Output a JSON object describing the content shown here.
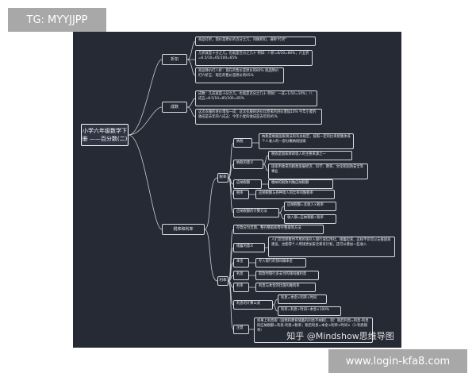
{
  "overlay": {
    "tag": "TG: MYYJJPP",
    "banner": "www.login-kfa8.com"
  },
  "watermark": "知乎 @Mindshow思维导图",
  "mindmap": {
    "root": "小学六年级数学下册 ——百分数(二)",
    "discount": {
      "title": "折扣",
      "items": [
        "商品打折，现价是原价的百分之几，叫做折扣，通称\"打折\"",
        "几折就是十分之几，也就是百分之几十 例如：八折=8/10=80%；六五折=6.5/10=65/100=65%",
        "商品降价打八折：现在的售价是原价的80% 商品降价打六折五：现在的售价是原价的65%"
      ]
    },
    "chengshu": {
      "title": "成数",
      "items": [
        "成数：几成就是十分之几，也就是百分之几十 例如：一成=1/10=10%；八成五=8.5/10=85/100=85%",
        "这次衣服的进价增加一成：这次衣服的进价比原来的进价增加10% 今年小麦的收成是去年的八成五：今年小麦的收成是去年的85%"
      ]
    },
    "tax": {
      "title": "税率和利率",
      "shuilv": {
        "title": "税率",
        "nashui": {
          "label": "纳税",
          "text": "纳税是根据国家税法的有关规定，按照一定的比率把集体或个人收入的一部分缴纳给国家"
        },
        "yiyi": {
          "label": "纳税的意义",
          "items": [
            "税收是国家财政收入的主要来源之一",
            "国家用收来的税款发展经济、科学、教育、文化和国防安全等事业"
          ]
        },
        "ynse": {
          "label": "应纳税额",
          "text": "缴纳的税款叫做应纳税额"
        },
        "rate": {
          "label": "税率",
          "text": "应纳税额与各种收入的比率叫做税率"
        },
        "calc": {
          "label": "应纳税额的计算方法",
          "items": [
            "应纳税额=总收入×税率",
            "收入额=应纳税额÷税率"
          ]
        }
      },
      "lilv": {
        "title": "利率",
        "intro": "存款分为活期、整存整取和零存整取等方法",
        "chuxu": {
          "label": "储蓄的意义",
          "text": "人们常常把暂时不用的钱存入银行或信用社，储蓄起来，这样不仅可以支援国家建设，也使得个人用钱更加安全和有计划，还可以增加一些收入"
        },
        "benjin": {
          "label": "本金",
          "text": "存入银行的钱叫做本金"
        },
        "lixi": {
          "label": "利息",
          "text": "取款时银行多支付的钱叫做利息"
        },
        "rate": {
          "label": "利率",
          "text": "利息与本金的比值叫做利率"
        },
        "formula": {
          "label": "利息的计算公式",
          "items": [
            "利息=本金×利率×时间",
            "利率=利息÷时间÷本金×100%"
          ]
        },
        "note": {
          "label": "注意",
          "text": "如果上利息税（国债和教育储蓄的利息不纳税），则：税后利息=利息-利息的应纳税额=利息-利息×税率；税后利息=本金×利率×时间×（1-利息税率）"
        }
      }
    }
  }
}
